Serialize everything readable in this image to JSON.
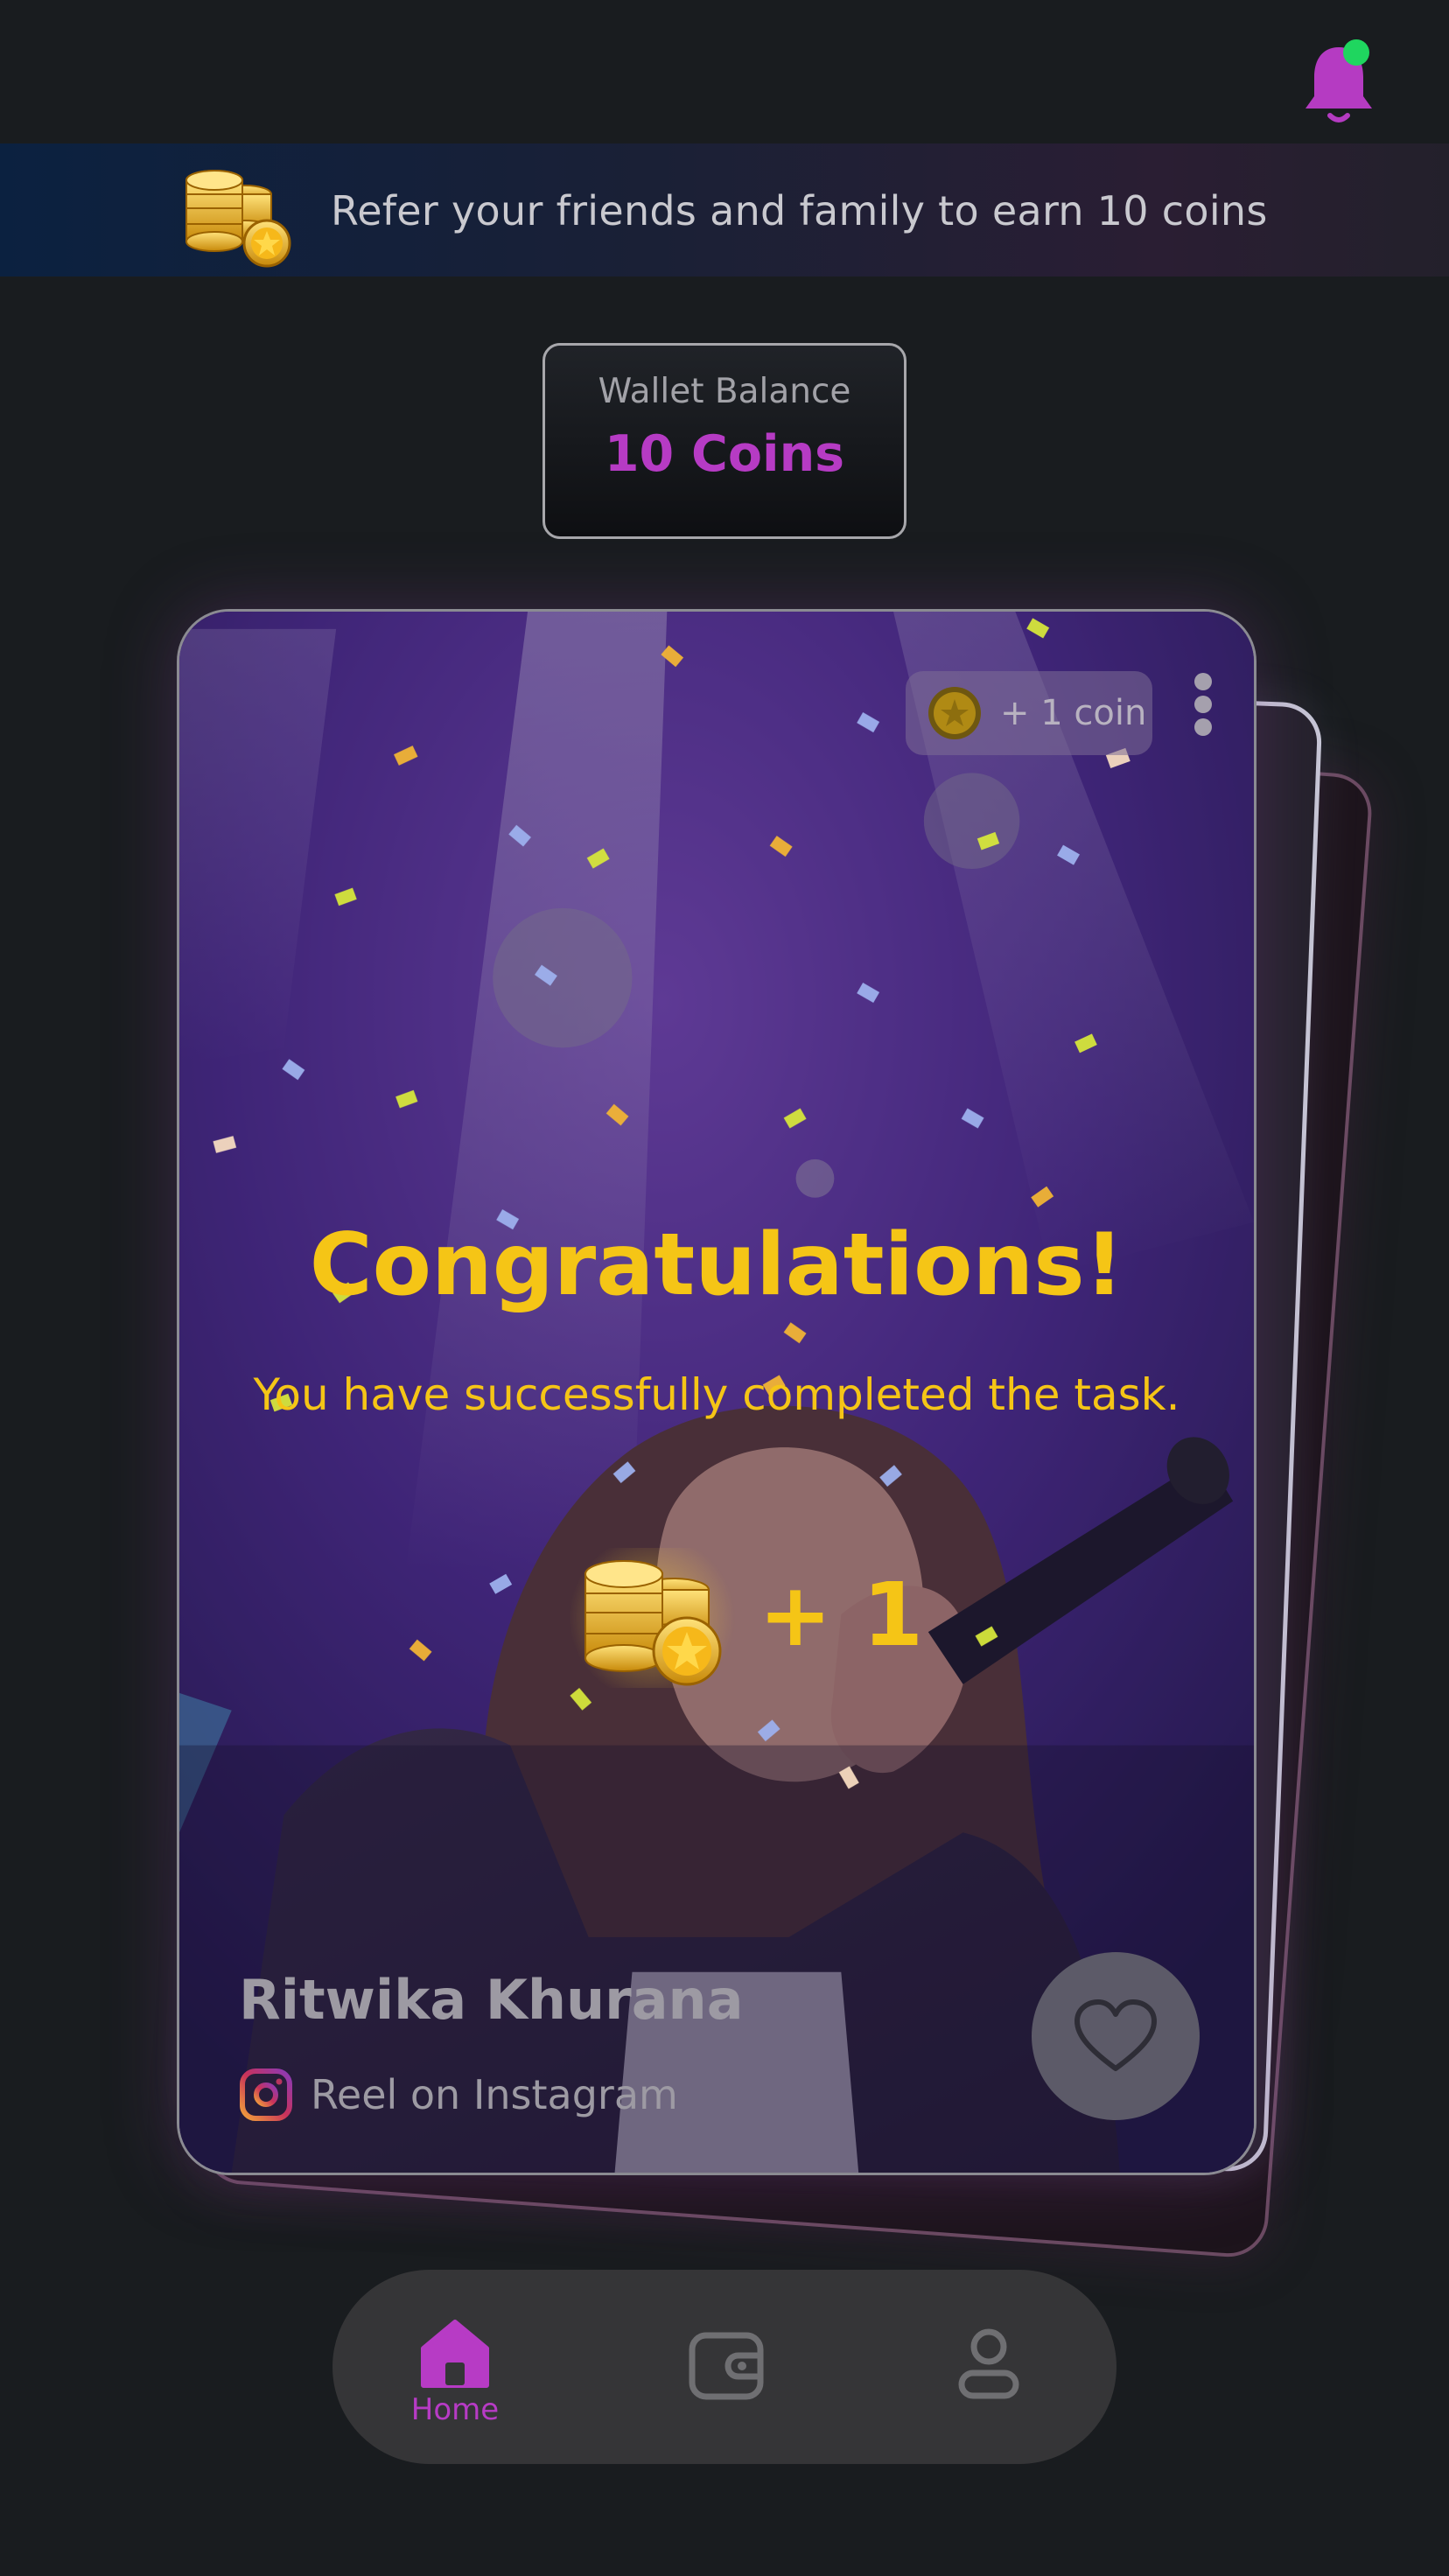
{
  "notifications": {
    "icon": "bell-icon",
    "has_unread": true,
    "accent": "#b53bc2",
    "dot_color": "#1fd65f"
  },
  "referral_banner": {
    "text": "Refer your friends and family to earn 10 coins",
    "icon": "coin-stack-icon"
  },
  "wallet": {
    "label": "Wallet Balance",
    "balance": "10 Coins",
    "balance_color": "#b63bc4"
  },
  "task_card": {
    "reward_badge": "+ 1 coin",
    "title": "Congratulations!",
    "message": "You have successfully completed the task.",
    "reward_amount": "+ 1",
    "creator_name": "Ritwika Khurana",
    "source_label": "Reel on Instagram",
    "title_color": "#f5c516"
  },
  "bottom_nav": {
    "items": [
      {
        "label": "Home",
        "icon": "home-icon",
        "active": true
      },
      {
        "label": "",
        "icon": "wallet-icon",
        "active": false
      },
      {
        "label": "",
        "icon": "profile-icon",
        "active": false
      }
    ],
    "active_color": "#b73bc5",
    "inactive_color": "#6f6f72"
  }
}
